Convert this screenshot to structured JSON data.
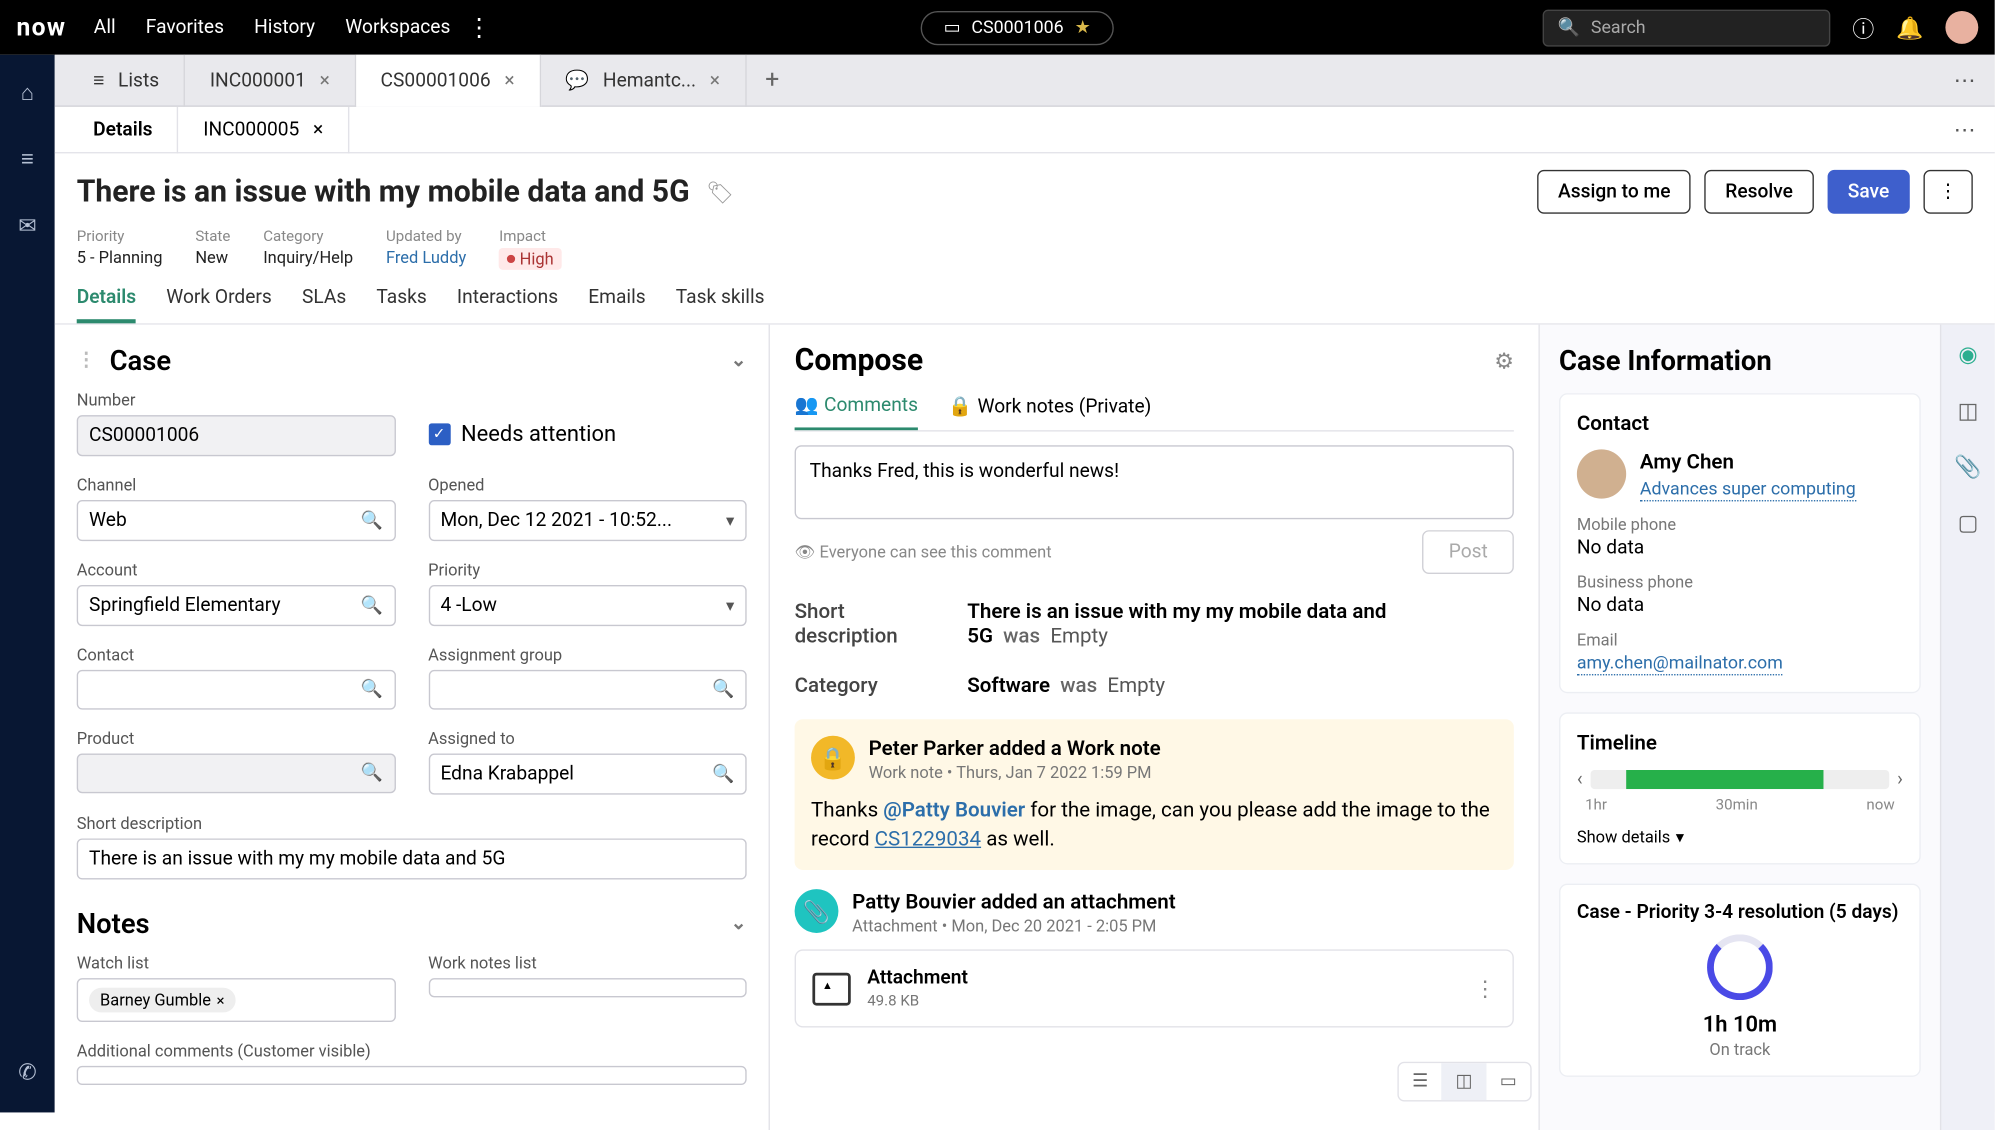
{
  "topbar": {
    "logo": "now",
    "nav": [
      "All",
      "Favorites",
      "History",
      "Workspaces"
    ],
    "breadcrumb": "CS0001006",
    "search_placeholder": "Search"
  },
  "tabs": {
    "items": [
      {
        "label": "Lists",
        "closeable": false,
        "icon": "list"
      },
      {
        "label": "INC000001",
        "closeable": true
      },
      {
        "label": "CS00001006",
        "closeable": true,
        "active": true
      },
      {
        "label": "Hemantc...",
        "closeable": true,
        "icon": "chat"
      }
    ]
  },
  "subtabs": {
    "items": [
      {
        "label": "Details",
        "active": true
      },
      {
        "label": "INC000005",
        "closeable": true
      }
    ]
  },
  "record": {
    "title": "There is an issue with my mobile data and 5G",
    "actions": {
      "assign": "Assign to me",
      "resolve": "Resolve",
      "save": "Save"
    },
    "meta": {
      "priority": {
        "label": "Priority",
        "value": "5 - Planning"
      },
      "state": {
        "label": "State",
        "value": "New"
      },
      "category": {
        "label": "Category",
        "value": "Inquiry/Help"
      },
      "updated_by": {
        "label": "Updated by",
        "value": "Fred Luddy"
      },
      "impact": {
        "label": "Impact",
        "value": "High"
      }
    },
    "tabs": [
      "Details",
      "Work Orders",
      "SLAs",
      "Tasks",
      "Interactions",
      "Emails",
      "Task skills"
    ]
  },
  "case": {
    "section_title": "Case",
    "number": {
      "label": "Number",
      "value": "CS00001006"
    },
    "needs_attention": {
      "label": "Needs attention",
      "checked": true
    },
    "channel": {
      "label": "Channel",
      "value": "Web"
    },
    "opened": {
      "label": "Opened",
      "value": "Mon, Dec 12 2021 - 10:52..."
    },
    "account": {
      "label": "Account",
      "value": "Springfield Elementary"
    },
    "priority": {
      "label": "Priority",
      "value": "4 -Low"
    },
    "contact": {
      "label": "Contact",
      "value": ""
    },
    "assignment_group": {
      "label": "Assignment group",
      "value": ""
    },
    "product": {
      "label": "Product",
      "value": ""
    },
    "assigned_to": {
      "label": "Assigned to",
      "value": "Edna Krabappel"
    },
    "short_description": {
      "label": "Short description",
      "value": "There is an issue with my my mobile data and 5G"
    }
  },
  "notes": {
    "section_title": "Notes",
    "watch_list": {
      "label": "Watch list",
      "chips": [
        "Barney Gumble"
      ]
    },
    "work_notes_list": {
      "label": "Work notes list"
    },
    "additional_comments": {
      "label": "Additional comments (Customer visible)"
    }
  },
  "compose": {
    "title": "Compose",
    "tabs": {
      "comments": "Comments",
      "work_notes": "Work notes (Private)"
    },
    "text": "Thanks Fred, this is wonderful news!",
    "visibility": "Everyone can see this comment",
    "post": "Post"
  },
  "changes": {
    "short_desc": {
      "label": "Short description",
      "value": "There is an issue with my my mobile data and 5G",
      "was": "was",
      "prev": "Empty"
    },
    "category": {
      "label": "Category",
      "value": "Software",
      "was": "was",
      "prev": "Empty"
    }
  },
  "activity": {
    "work_note": {
      "title": "Peter Parker added a Work note",
      "sub": "Work note   •   Thurs, Jan 7 2022 1:59 PM",
      "pre": "Thanks ",
      "mention": "@Patty Bouvier",
      "mid": " for the image, can you please add the image to the record ",
      "link": "CS1229034",
      "post": " as well."
    },
    "attachment": {
      "title": "Patty Bouvier added an attachment",
      "sub": "Attachment   •   Mon, Dec 20 2021  -  2:05 PM",
      "file_title": "Attachment",
      "file_size": "49.8 KB"
    }
  },
  "info": {
    "title": "Case Information",
    "contact": {
      "heading": "Contact",
      "name": "Amy Chen",
      "company": "Advances super computing",
      "mobile": {
        "label": "Mobile phone",
        "value": "No data"
      },
      "business": {
        "label": "Business phone",
        "value": "No data"
      },
      "email": {
        "label": "Email",
        "value": "amy.chen@mailnator.com"
      }
    },
    "timeline": {
      "heading": "Timeline",
      "labels": [
        "1hr",
        "30min",
        "now"
      ],
      "show_details": "Show details"
    },
    "sla": {
      "heading": "Case - Priority 3-4 resolution (5 days)",
      "time": "1h 10m",
      "status": "On track"
    }
  }
}
